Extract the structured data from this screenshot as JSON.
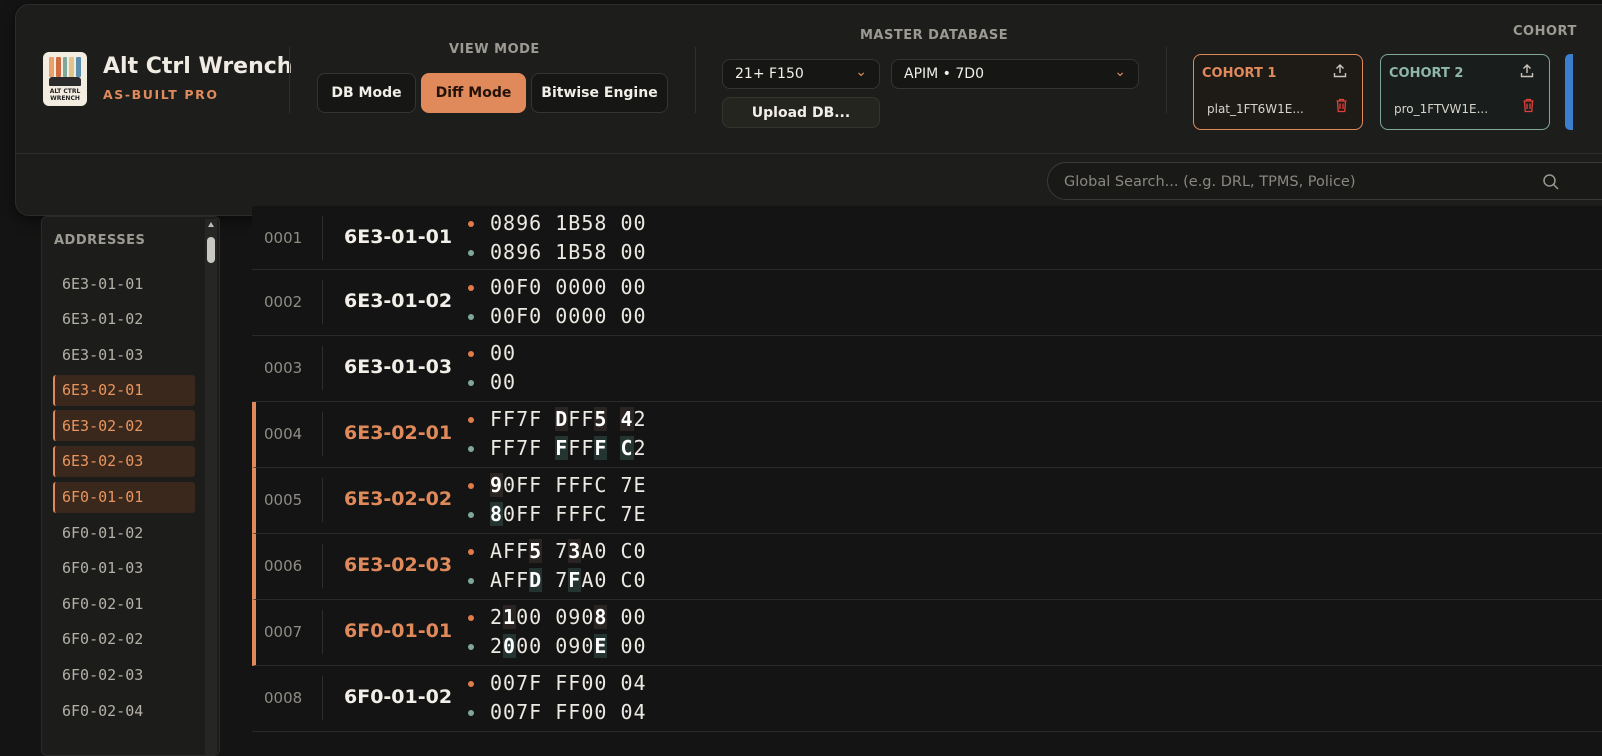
{
  "app": {
    "title": "Alt Ctrl Wrench",
    "subtitle": "AS-BUILT PRO",
    "logo_text": "ALT CTRL WRENCH"
  },
  "view_mode": {
    "label": "VIEW MODE",
    "buttons": [
      {
        "label": "DB Mode",
        "active": false
      },
      {
        "label": "Diff Mode",
        "active": true
      },
      {
        "label": "Bitwise Engine",
        "active": false
      }
    ]
  },
  "master_db": {
    "label": "MASTER DATABASE",
    "vehicle": "21+ F150",
    "module": "APIM • 7D0",
    "upload_label": "Upload DB..."
  },
  "cohorts": {
    "section_label": "COHORT",
    "items": [
      {
        "title": "COHORT 1",
        "file": "plat_1FT6W1E...",
        "color": "#e08a5c"
      },
      {
        "title": "COHORT 2",
        "file": "pro_1FTVW1E...",
        "color": "#8fb8aa"
      }
    ]
  },
  "search": {
    "placeholder": "Global Search... (e.g. DRL, TPMS, Police)"
  },
  "sidebar": {
    "title": "ADDRESSES",
    "items": [
      {
        "label": "6E3-01-01",
        "diff": false
      },
      {
        "label": "6E3-01-02",
        "diff": false
      },
      {
        "label": "6E3-01-03",
        "diff": false
      },
      {
        "label": "6E3-02-01",
        "diff": true
      },
      {
        "label": "6E3-02-02",
        "diff": true
      },
      {
        "label": "6E3-02-03",
        "diff": true
      },
      {
        "label": "6F0-01-01",
        "diff": true
      },
      {
        "label": "6F0-01-02",
        "diff": false
      },
      {
        "label": "6F0-01-03",
        "diff": false
      },
      {
        "label": "6F0-02-01",
        "diff": false
      },
      {
        "label": "6F0-02-02",
        "diff": false
      },
      {
        "label": "6F0-02-03",
        "diff": false
      },
      {
        "label": "6F0-02-04",
        "diff": false
      }
    ]
  },
  "rows": [
    {
      "num": "0001",
      "addr": "6E3-01-01",
      "diff": false,
      "c1": "0896 1B58 00",
      "c2": "0896 1B58 00"
    },
    {
      "num": "0002",
      "addr": "6E3-01-02",
      "diff": false,
      "c1": "00F0 0000 00",
      "c2": "00F0 0000 00"
    },
    {
      "num": "0003",
      "addr": "6E3-01-03",
      "diff": false,
      "c1": "00",
      "c2": "00"
    },
    {
      "num": "0004",
      "addr": "6E3-02-01",
      "diff": true,
      "c1": "FF7F DFF5 42",
      "c2": "FF7F FFFF C2"
    },
    {
      "num": "0005",
      "addr": "6E3-02-02",
      "diff": true,
      "c1": "90FF FFFC 7E",
      "c2": "80FF FFFC 7E"
    },
    {
      "num": "0006",
      "addr": "6E3-02-03",
      "diff": true,
      "c1": "AFF5 73A0 C0",
      "c2": "AFFD 7FA0 C0"
    },
    {
      "num": "0007",
      "addr": "6F0-01-01",
      "diff": true,
      "c1": "2100 0908 00",
      "c2": "2000 090E 00"
    },
    {
      "num": "0008",
      "addr": "6F0-01-02",
      "diff": false,
      "c1": "007F FF00 04",
      "c2": "007F FF00 04"
    }
  ]
}
